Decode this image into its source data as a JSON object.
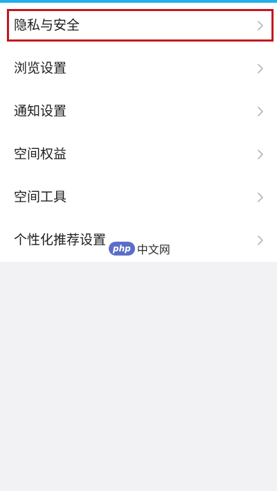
{
  "colors": {
    "top_bar": "#1fb1ea",
    "highlight_border": "#c3141c",
    "background": "#f2f2f4",
    "list_background": "#ffffff"
  },
  "menu": {
    "items": [
      {
        "label": "隐私与安全",
        "icon": "chevron-right-icon",
        "highlighted": true
      },
      {
        "label": "浏览设置",
        "icon": "chevron-right-icon"
      },
      {
        "label": "通知设置",
        "icon": "chevron-right-icon"
      },
      {
        "label": "空间权益",
        "icon": "chevron-right-icon"
      },
      {
        "label": "空间工具",
        "icon": "chevron-right-icon"
      },
      {
        "label": "个性化推荐设置",
        "icon": "chevron-right-icon"
      }
    ]
  },
  "watermark": {
    "badge": "php",
    "text": "中文网"
  }
}
